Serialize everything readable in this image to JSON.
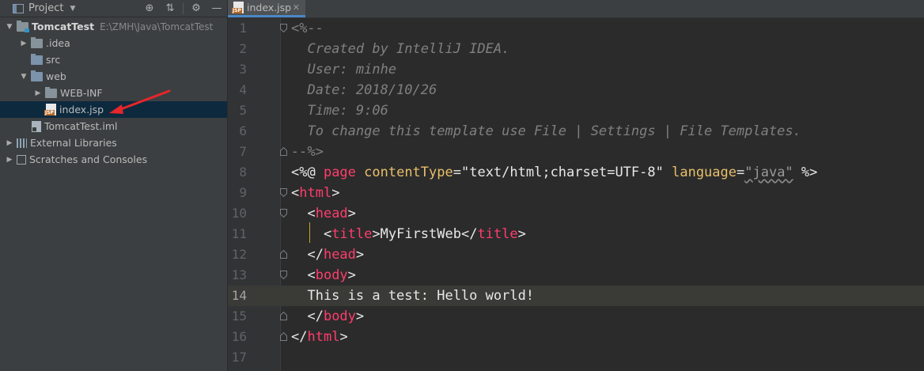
{
  "project_panel": {
    "title": "Project",
    "tools": [
      "⊕",
      "⇅",
      "⚙",
      "—"
    ],
    "tree": [
      {
        "label": "TomcatTest",
        "path": "E:\\ZMH\\Java\\TomcatTest",
        "expanded": true
      },
      {
        "label": ".idea",
        "expanded": false
      },
      {
        "label": "src"
      },
      {
        "label": "web",
        "expanded": true
      },
      {
        "label": "WEB-INF",
        "expanded": false
      },
      {
        "label": "index.jsp",
        "selected": true
      },
      {
        "label": "TomcatTest.iml"
      },
      {
        "label": "External Libraries",
        "expanded": false
      },
      {
        "label": "Scratches and Consoles",
        "expanded": false
      }
    ]
  },
  "editor": {
    "tab": {
      "label": "index.jsp",
      "badge": "JSP"
    },
    "current_line": 14,
    "lines": [
      {
        "n": "1",
        "parts": [
          {
            "t": "<%--",
            "c": "cm"
          }
        ]
      },
      {
        "n": "2",
        "parts": [
          {
            "t": "  Created by IntelliJ IDEA.",
            "c": "cm"
          }
        ]
      },
      {
        "n": "3",
        "parts": [
          {
            "t": "  User: minhe",
            "c": "cm"
          }
        ]
      },
      {
        "n": "4",
        "parts": [
          {
            "t": "  Date: 2018/10/26",
            "c": "cm"
          }
        ]
      },
      {
        "n": "5",
        "parts": [
          {
            "t": "  Time: 9:06",
            "c": "cm"
          }
        ]
      },
      {
        "n": "6",
        "parts": [
          {
            "t": "  To change this template use File | Settings | File Templates.",
            "c": "cm"
          }
        ]
      },
      {
        "n": "7",
        "parts": [
          {
            "t": "--%>",
            "c": "cm"
          }
        ]
      },
      {
        "n": "8",
        "parts": [
          {
            "t": "<%@ ",
            "c": "br"
          },
          {
            "t": "page ",
            "c": "dir"
          },
          {
            "t": "contentType",
            "c": "attr"
          },
          {
            "t": "=",
            "c": "br"
          },
          {
            "t": "\"text/html;charset=UTF-8\"",
            "c": "str"
          },
          {
            "t": " ",
            "c": "br"
          },
          {
            "t": "language",
            "c": "attr"
          },
          {
            "t": "=",
            "c": "br"
          },
          {
            "t": "\"java\"",
            "c": "strwarn"
          },
          {
            "t": " %>",
            "c": "br"
          }
        ]
      },
      {
        "n": "9",
        "parts": [
          {
            "t": "<",
            "c": "br"
          },
          {
            "t": "html",
            "c": "tg"
          },
          {
            "t": ">",
            "c": "br"
          }
        ]
      },
      {
        "n": "10",
        "parts": [
          {
            "t": "  <",
            "c": "br"
          },
          {
            "t": "head",
            "c": "tg"
          },
          {
            "t": ">",
            "c": "br"
          }
        ]
      },
      {
        "n": "11",
        "parts": [
          {
            "t": "    <",
            "c": "br"
          },
          {
            "t": "title",
            "c": "tg"
          },
          {
            "t": ">",
            "c": "br"
          },
          {
            "t": "MyFirstWeb",
            "c": "txt"
          },
          {
            "t": "</",
            "c": "br"
          },
          {
            "t": "title",
            "c": "tg"
          },
          {
            "t": ">",
            "c": "br"
          }
        ]
      },
      {
        "n": "12",
        "parts": [
          {
            "t": "  </",
            "c": "br"
          },
          {
            "t": "head",
            "c": "tg"
          },
          {
            "t": ">",
            "c": "br"
          }
        ]
      },
      {
        "n": "13",
        "parts": [
          {
            "t": "  <",
            "c": "br"
          },
          {
            "t": "body",
            "c": "tg"
          },
          {
            "t": ">",
            "c": "br"
          }
        ]
      },
      {
        "n": "14",
        "parts": [
          {
            "t": "  This is a test: Hello world!",
            "c": "txt"
          }
        ]
      },
      {
        "n": "15",
        "parts": [
          {
            "t": "  </",
            "c": "br"
          },
          {
            "t": "body",
            "c": "tg"
          },
          {
            "t": ">",
            "c": "br"
          }
        ]
      },
      {
        "n": "16",
        "parts": [
          {
            "t": "</",
            "c": "br"
          },
          {
            "t": "html",
            "c": "tg"
          },
          {
            "t": ">",
            "c": "br"
          }
        ]
      },
      {
        "n": "17",
        "parts": []
      }
    ]
  }
}
